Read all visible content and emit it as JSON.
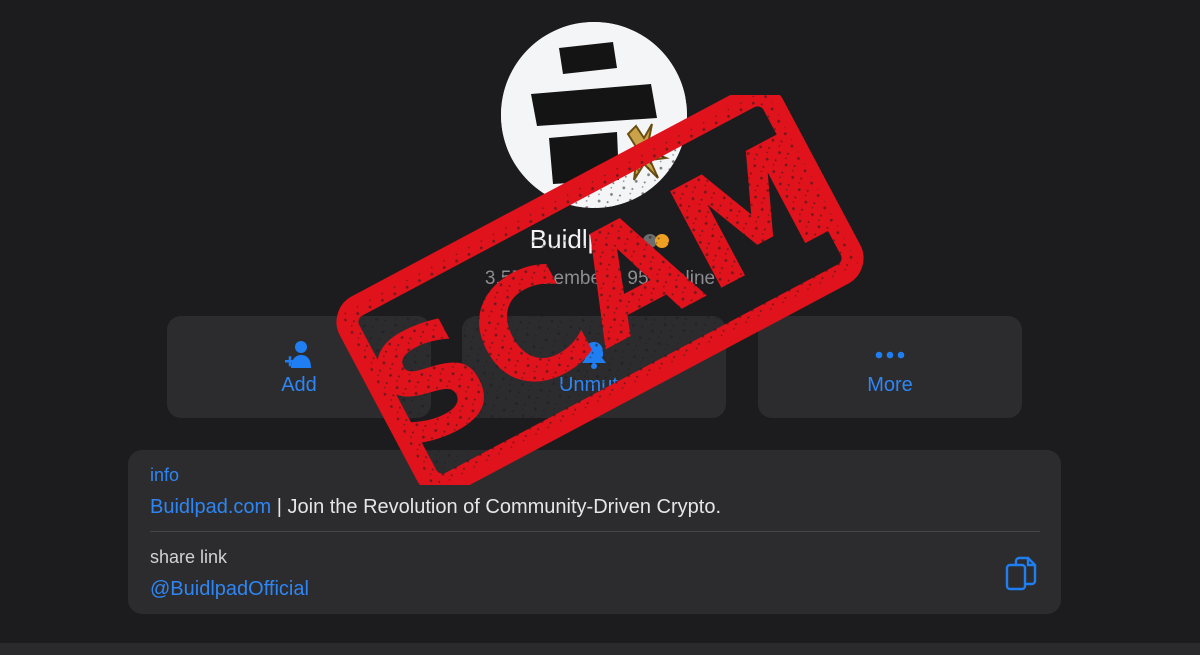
{
  "group": {
    "name": "Buidlpad",
    "members": "3,557 members, 955 online"
  },
  "actions": [
    {
      "label": "Add",
      "icon": "add-person-icon"
    },
    {
      "label": "Unmute",
      "icon": "bell-icon"
    },
    {
      "label": "More",
      "icon": "more-dots-icon"
    }
  ],
  "info": {
    "label": "info",
    "link_text": "Buidlpad.com",
    "description": " | Join the Revolution of Community-Driven Crypto."
  },
  "share": {
    "label": "share link",
    "link": "@BuidlpadOfficial",
    "copy_icon": "copy-icon"
  },
  "stamp": {
    "text": "SCAM",
    "color": "#e0121b"
  },
  "colors": {
    "background": "#1c1c1e",
    "card": "#2c2c2e",
    "accent": "#2e86f5"
  }
}
